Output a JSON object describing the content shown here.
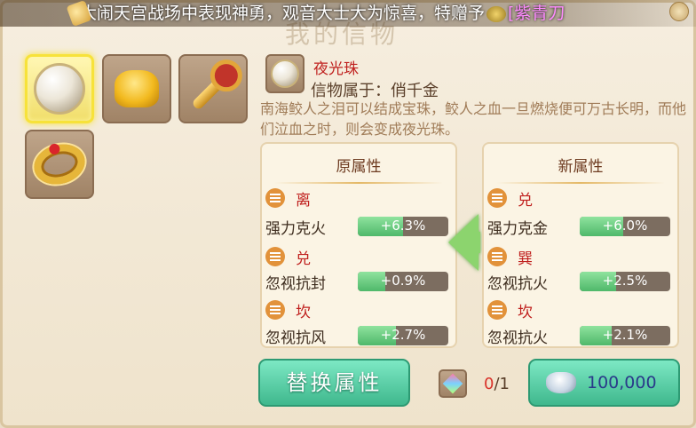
{
  "broadcast": {
    "text_main": "大闹天宫战场中表现神勇，观音大士大为惊喜，特赠予",
    "text_highlight": "[紫青刀"
  },
  "panel": {
    "title_faded": "我的信物"
  },
  "inventory": [
    {
      "name": "夜光珠",
      "icon": "pearl-icon",
      "selected": true
    },
    {
      "name": "金元宝",
      "icon": "gold-ingot-icon",
      "selected": false
    },
    {
      "name": "金钥匙",
      "icon": "golden-key-icon",
      "selected": false
    },
    {
      "name": "金戒指",
      "icon": "gold-ring-icon",
      "selected": false
    }
  ],
  "item": {
    "name": "夜光珠",
    "belongs_label": "信物属于：",
    "owner": "俏千金",
    "description": "南海鲛人之泪可以结成宝珠，鲛人之血一旦燃烧便可万古长明，而他们泣血之时，则会变成夜光珠。"
  },
  "old_attrs": {
    "header": "原属性",
    "groups": [
      {
        "trigram": "离",
        "stat": "强力克火",
        "value": "+6.3%",
        "fill": 0.5
      },
      {
        "trigram": "兑",
        "stat": "忽视抗封",
        "value": "+0.9%",
        "fill": 0.3
      },
      {
        "trigram": "坎",
        "stat": "忽视抗风",
        "value": "+2.7%",
        "fill": 0.42
      }
    ]
  },
  "new_attrs": {
    "header": "新属性",
    "groups": [
      {
        "trigram": "兑",
        "stat": "强力克金",
        "value": "+6.0%",
        "fill": 0.48
      },
      {
        "trigram": "巽",
        "stat": "忽视抗火",
        "value": "+2.5%",
        "fill": 0.4
      },
      {
        "trigram": "坎",
        "stat": "忽视抗火",
        "value": "+2.1%",
        "fill": 0.35
      }
    ]
  },
  "actions": {
    "replace_label": "替换属性",
    "gem_current": "0",
    "gem_total": "/1",
    "cost_value": "100,000"
  },
  "colors": {
    "accent_green": "#3fb88d",
    "red_text": "#c0211f",
    "bar_fill": "#4fb86a"
  }
}
